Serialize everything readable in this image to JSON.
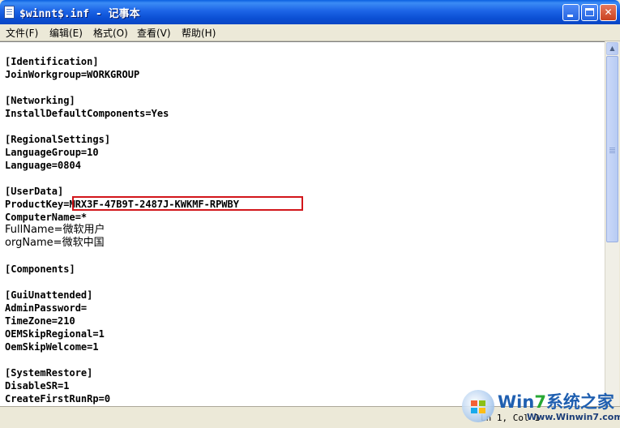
{
  "window": {
    "title": "$winnt$.inf - 记事本"
  },
  "title_buttons": {
    "minimize": "",
    "maximize": "",
    "close": "✕"
  },
  "menu": [
    {
      "label": "文件(F)"
    },
    {
      "label": "编辑(E)"
    },
    {
      "label": "格式(O)"
    },
    {
      "label": "查看(V)"
    },
    {
      "label": "帮助(H)"
    }
  ],
  "content": {
    "lines": [
      "",
      "[Identification]",
      "JoinWorkgroup=WORKGROUP",
      "",
      "[Networking]",
      "InstallDefaultComponents=Yes",
      "",
      "[RegionalSettings]",
      "LanguageGroup=10",
      "Language=0804",
      "",
      "[UserData]",
      "ProductKey=MRX3F-47B9T-2487J-KWKMF-RPWBY",
      "ComputerName=*",
      "FullName=微软用户",
      "orgName=微软中国",
      "",
      "[Components]",
      "",
      "[GuiUnattended]",
      "AdminPassword=",
      "TimeZone=210",
      "OEMSkipRegional=1",
      "OemSkipWelcome=1",
      "",
      "[SystemRestore]",
      "DisableSR=1",
      "CreateFirstRunRp=0"
    ]
  },
  "statusbar": {
    "position": "Ln 1, Col 1"
  },
  "watermark": {
    "brand_prefix": "Win",
    "brand_digit": "7",
    "brand_suffix": "系统之家",
    "url": "Www.Winwin7.com"
  },
  "colors": {
    "highlight_border": "#d2161b",
    "titlebar": "#0b4fd4"
  },
  "icons": {
    "app": "notepad-icon",
    "scroll_up": "arrow-up-icon"
  }
}
